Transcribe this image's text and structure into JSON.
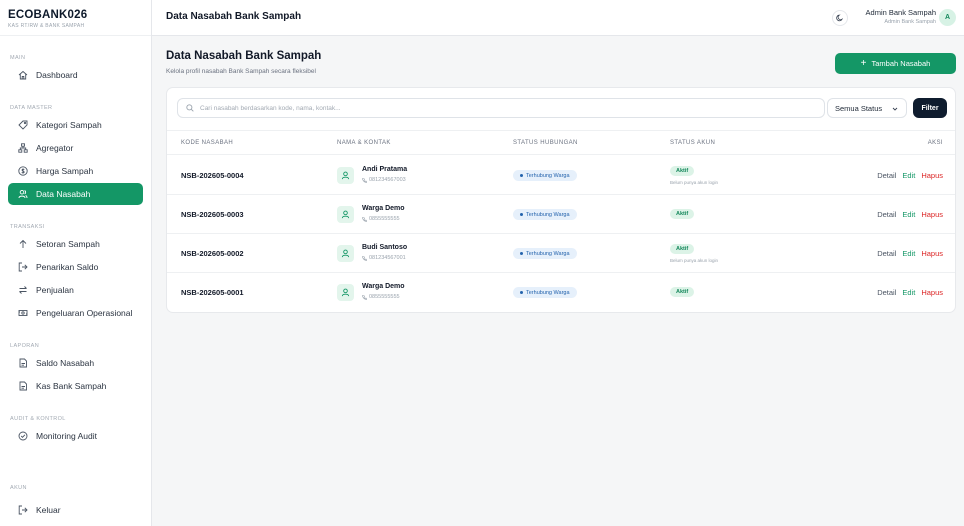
{
  "brand": {
    "name": "ECOBANK026",
    "subtitle": "KAS RT/RW & BANK SAMPAH"
  },
  "sidebar": {
    "sections": [
      {
        "title": "MAIN",
        "items": [
          {
            "label": "Dashboard",
            "icon": "home-icon",
            "active": false
          }
        ]
      },
      {
        "title": "DATA MASTER",
        "items": [
          {
            "label": "Kategori Sampah",
            "icon": "tag-icon",
            "active": false
          },
          {
            "label": "Agregator",
            "icon": "network-icon",
            "active": false
          },
          {
            "label": "Harga Sampah",
            "icon": "dollar-icon",
            "active": false
          },
          {
            "label": "Data Nasabah",
            "icon": "users-icon",
            "active": true
          }
        ]
      },
      {
        "title": "TRANSAKSI",
        "items": [
          {
            "label": "Setoran Sampah",
            "icon": "arrow-up-icon",
            "active": false
          },
          {
            "label": "Penarikan Saldo",
            "icon": "log-out-icon",
            "active": false
          },
          {
            "label": "Penjualan",
            "icon": "swap-icon",
            "active": false
          },
          {
            "label": "Pengeluaran Operasional",
            "icon": "cash-icon",
            "active": false
          }
        ]
      },
      {
        "title": "LAPORAN",
        "items": [
          {
            "label": "Saldo Nasabah",
            "icon": "file-icon",
            "active": false
          },
          {
            "label": "Kas Bank Sampah",
            "icon": "file-icon",
            "active": false
          }
        ]
      },
      {
        "title": "AUDIT & KONTROL",
        "items": [
          {
            "label": "Monitoring Audit",
            "icon": "check-circle-icon",
            "active": false
          }
        ]
      }
    ],
    "bottom": {
      "title": "AKUN",
      "items": [
        {
          "label": "Keluar",
          "icon": "logout-icon"
        }
      ]
    }
  },
  "topbar": {
    "title": "Data Nasabah Bank Sampah",
    "user_name": "Admin Bank Sampah",
    "user_role": "Admin Bank Sampah",
    "avatar_initial": "A"
  },
  "page": {
    "title": "Data Nasabah Bank Sampah",
    "subtitle": "Kelola profil nasabah Bank Sampah secara fleksibel",
    "add_button": "Tambah Nasabah"
  },
  "filters": {
    "search_placeholder": "Cari nasabah berdasarkan kode, nama, kontak...",
    "status_selected": "Semua Status",
    "filter_button": "Filter"
  },
  "table": {
    "headers": {
      "code": "KODE NASABAH",
      "name": "NAMA & KONTAK",
      "relation": "STATUS HUBUNGAN",
      "account": "STATUS AKUN",
      "actions": "AKSI"
    },
    "action_labels": {
      "detail": "Detail",
      "edit": "Edit",
      "delete": "Hapus"
    },
    "rows": [
      {
        "code": "NSB-202605-0004",
        "name": "Andi Pratama",
        "phone": "081234567003",
        "relation": "Terhubung Warga",
        "account": "Aktif",
        "account_note": "Belum punya akun login"
      },
      {
        "code": "NSB-202605-0003",
        "name": "Warga Demo",
        "phone": "0855555555",
        "relation": "Terhubung Warga",
        "account": "Aktif",
        "account_note": ""
      },
      {
        "code": "NSB-202605-0002",
        "name": "Budi Santoso",
        "phone": "081234567001",
        "relation": "Terhubung Warga",
        "account": "Aktif",
        "account_note": "Belum punya akun login"
      },
      {
        "code": "NSB-202605-0001",
        "name": "Warga Demo",
        "phone": "0855555555",
        "relation": "Terhubung Warga",
        "account": "Aktif",
        "account_note": ""
      }
    ]
  },
  "colors": {
    "primary": "#149766",
    "dark": "#0f1c2e",
    "danger": "#dc2626",
    "badge_blue": "#2463ad"
  }
}
